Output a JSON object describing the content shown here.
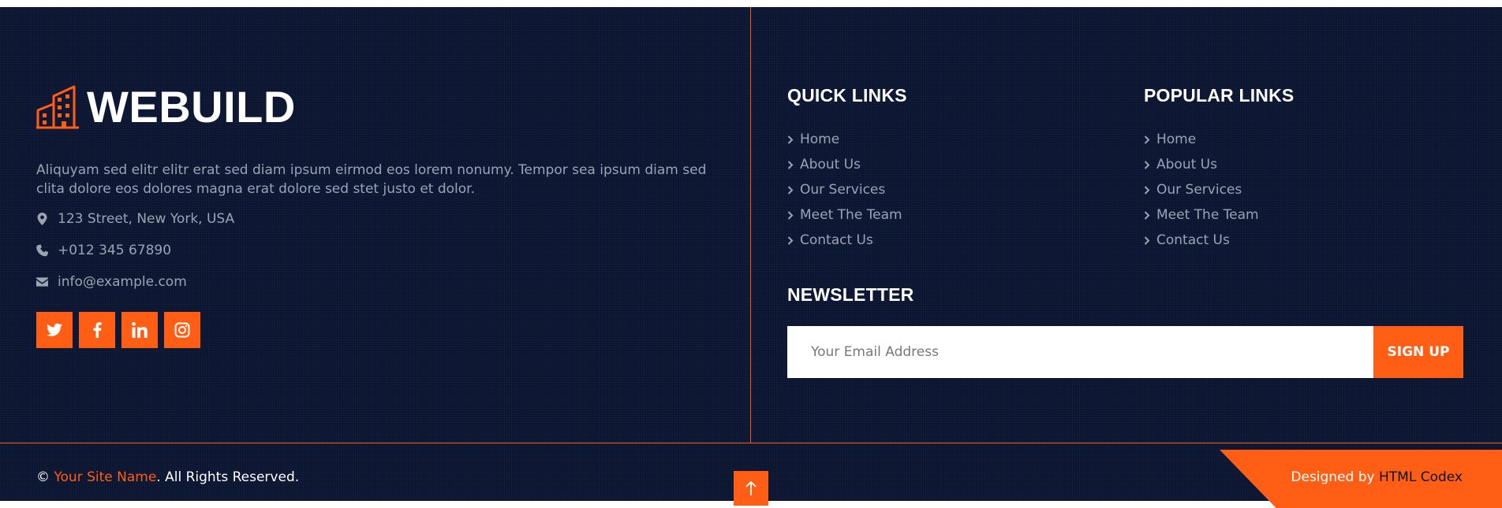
{
  "brand": {
    "name": "WEBUILD",
    "icon": "building-icon"
  },
  "about": {
    "text": "Aliquyam sed elitr elitr erat sed diam ipsum eirmod eos lorem nonumy. Tempor sea ipsum diam sed clita dolore eos dolores magna erat dolore sed stet justo et dolor."
  },
  "contact": {
    "address": "123 Street, New York, USA",
    "phone": "+012 345 67890",
    "email": "info@example.com"
  },
  "socials": [
    "twitter-icon",
    "facebook-icon",
    "linkedin-icon",
    "instagram-icon"
  ],
  "quick_links": {
    "title": "QUICK LINKS",
    "items": [
      "Home",
      "About Us",
      "Our Services",
      "Meet The Team",
      "Contact Us"
    ]
  },
  "popular_links": {
    "title": "POPULAR LINKS",
    "items": [
      "Home",
      "About Us",
      "Our Services",
      "Meet The Team",
      "Contact Us"
    ]
  },
  "newsletter": {
    "title": "NEWSLETTER",
    "placeholder": "Your Email Address",
    "button": "SIGN UP"
  },
  "bottom": {
    "copyright_prefix": "© ",
    "site_name": "Your Site Name",
    "copyright_suffix": ". All Rights Reserved.",
    "designed_prefix": "Designed by ",
    "designer": "HTML Codex"
  },
  "colors": {
    "accent": "#ff5e14",
    "background": "#0b1430",
    "muted_text": "#9ca3b3"
  }
}
